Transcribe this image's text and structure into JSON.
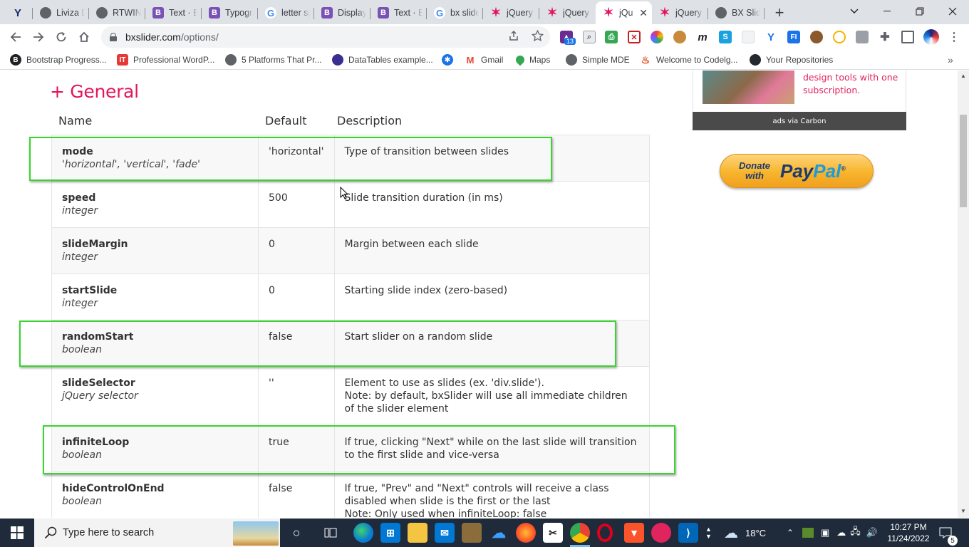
{
  "tabs": [
    {
      "label": "Liviza D",
      "icon": "globe-icon"
    },
    {
      "label": "RTWIN",
      "icon": "globe-icon"
    },
    {
      "label": "Text · Bo",
      "icon": "bootstrap-icon"
    },
    {
      "label": "Typogra",
      "icon": "bootstrap-icon"
    },
    {
      "label": "letter sp",
      "icon": "google-icon"
    },
    {
      "label": "Display",
      "icon": "bootstrap-icon"
    },
    {
      "label": "Text · Bo",
      "icon": "bootstrap-icon"
    },
    {
      "label": "bx slide",
      "icon": "google-icon"
    },
    {
      "label": "jQuery",
      "icon": "bxslider-icon"
    },
    {
      "label": "jQuery",
      "icon": "bxslider-icon"
    },
    {
      "label": "jQu",
      "icon": "bxslider-icon",
      "active": true
    },
    {
      "label": "jQuery",
      "icon": "bxslider-icon"
    },
    {
      "label": "BX Slide",
      "icon": "globe-icon"
    }
  ],
  "address": {
    "host": "bxslider.com",
    "path": "/options/"
  },
  "extension_badge": "13",
  "bookmarks": [
    "Bootstrap Progress...",
    "Professional WordP...",
    "5 Platforms That Pr...",
    "DataTables example...",
    "",
    "Gmail",
    "Maps",
    "Simple MDE",
    "Welcome to Codelg...",
    "Your Repositories"
  ],
  "page": {
    "section_title": "+ General",
    "columns": {
      "name": "Name",
      "default": "Default",
      "description": "Description"
    },
    "options": [
      {
        "name": "mode",
        "type": "'horizontal', 'vertical', 'fade'",
        "default": "'horizontal'",
        "description": [
          "Type of transition between slides"
        ]
      },
      {
        "name": "speed",
        "type": "integer",
        "default": "500",
        "description": [
          "Slide transition duration (in ms)"
        ]
      },
      {
        "name": "slideMargin",
        "type": "integer",
        "default": "0",
        "description": [
          "Margin between each slide"
        ]
      },
      {
        "name": "startSlide",
        "type": "integer",
        "default": "0",
        "description": [
          "Starting slide index (zero-based)"
        ]
      },
      {
        "name": "randomStart",
        "type": "boolean",
        "default": "false",
        "description": [
          "Start slider on a random slide"
        ]
      },
      {
        "name": "slideSelector",
        "type": "jQuery selector",
        "default": "''",
        "description": [
          "Element to use as slides (ex. 'div.slide').",
          "Note: by default, bxSlider will use all immediate children of the slider element"
        ]
      },
      {
        "name": "infiniteLoop",
        "type": "boolean",
        "default": "true",
        "description": [
          "If true, clicking \"Next\" while on the last slide will transition to the first slide and vice-versa"
        ]
      },
      {
        "name": "hideControlOnEnd",
        "type": "boolean",
        "default": "false",
        "description": [
          "If true, \"Prev\" and \"Next\" controls will receive a class disabled when slide is the first or the last",
          "Note: Only used when infiniteLoop: false"
        ]
      }
    ],
    "ad": {
      "text": "design tools with one subscription.",
      "footer": "ads via Carbon"
    },
    "donate": {
      "line1": "Donate",
      "line2": "with",
      "brand_a": "Pay",
      "brand_b": "Pal",
      "tm": "®"
    }
  },
  "taskbar": {
    "search_placeholder": "Type here to search",
    "weather": "18°C",
    "time": "10:27 PM",
    "date": "11/24/2022",
    "notifications": "5"
  }
}
